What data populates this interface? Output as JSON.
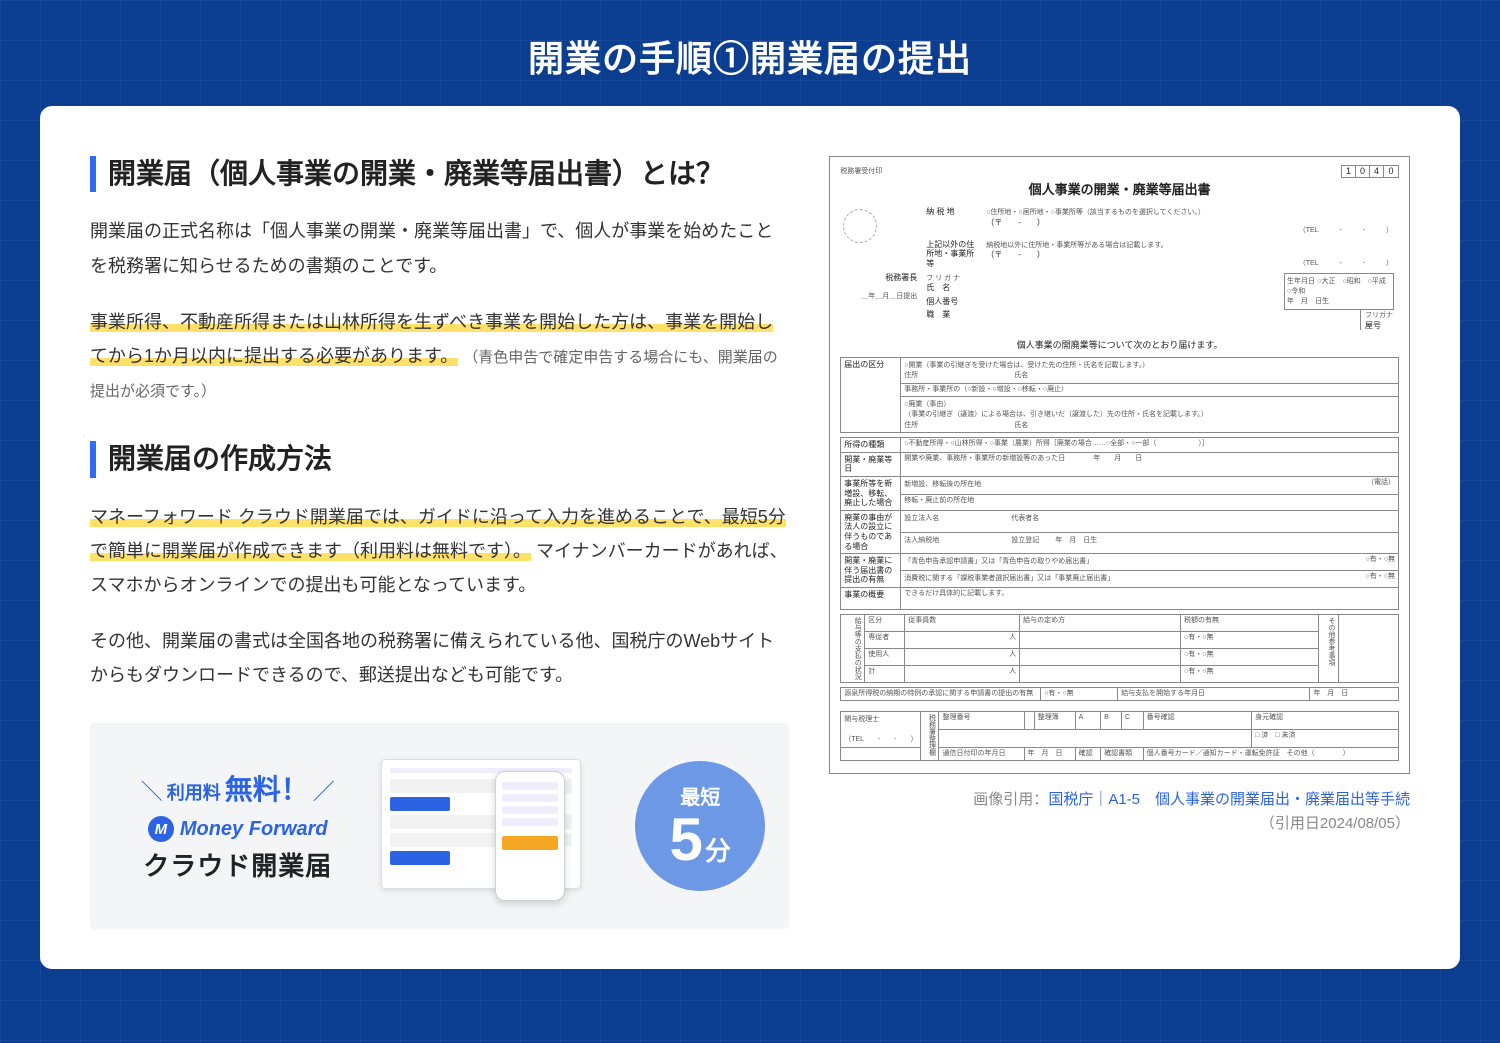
{
  "page_title": "開業の手順①開業届の提出",
  "section1": {
    "heading": "開業届（個人事業の開業・廃業等届出書）とは？",
    "para1": "開業届の正式名称は「個人事業の開業・廃業等届出書」で、個人が事業を始めたことを税務署に知らせるための書類のことです。",
    "highlight1": "事業所得、不動産所得または山林所得を生ずべき事業を開始した方は、事業を開始してから1か月以内に提出する必要があります。",
    "note1": "（青色申告で確定申告する場合にも、開業届の提出が必須です。）"
  },
  "section2": {
    "heading": "開業届の作成方法",
    "highlight2": "マネーフォワード クラウド開業届では、ガイドに沿って入力を進めることで、最短5分で簡単に開業届が作成できます（利用料は無料です）。",
    "para2_rest": "マイナンバーカードがあれば、スマホからオンラインでの提出も可能となっています。",
    "para3": "その他、開業届の書式は全国各地の税務署に備えられている他、国税庁のWebサイトからもダウンロードできるので、郵送提出なども可能です。"
  },
  "promo": {
    "free_prefix": "利用料",
    "free_big": "無料！",
    "brand": "Money Forward",
    "product": "クラウド開業届",
    "badge_line1": "最短",
    "badge_num": "5",
    "badge_unit": "分"
  },
  "form": {
    "reception_label": "税務署受付印",
    "code": [
      "1",
      "0",
      "4",
      "0"
    ],
    "title": "個人事業の開業・廃業等届出書",
    "field_address_note": "○住所地・○居所地・○事業所等（該当するものを選択してください。）",
    "tel_label": "（TEL　　　-　　　-　　　）",
    "tax_office_label": "税務署長",
    "submit_date_tpl": "＿年＿月＿日提出",
    "noukei_label": "納 税 地",
    "other_addr_label": "上記以外の住所地・事業所等",
    "other_addr_note": "納税地以外に住所地・事業所等がある場合は記載します。",
    "furigana": "フ リ ガ ナ",
    "name_label": "氏　名",
    "era_options": "○大正　○昭和　○平成　○令和",
    "birth_label": "生年月日",
    "ymd": "年　月　日生",
    "mynumber_label": "個人番号",
    "occupation_label": "職　業",
    "yago_furigana": "フリガナ",
    "yago_label": "屋号",
    "intro": "個人事業の開廃業等について次のとおり届けます。",
    "todokede_kubun_label": "届出の区分",
    "kubun_open": "○開業（事業の引継ぎを受けた場合は、受けた先の住所・氏名を記載します。）",
    "kubun_addr": "住所",
    "kubun_name": "氏名",
    "kubun_office": "事務所・事業所の（○新設・○増設・○移転・○廃止）",
    "kubun_close": "○廃業（事由）",
    "kubun_close_note": "（事業の引継ぎ（譲渡）による場合は、引き継いだ（譲渡した）先の住所・氏名を記載します。）",
    "income_type_label": "所得の種類",
    "income_type_value": "○不動産所得・○山林所得・○事業（農業）所得［廃業の場合……○全部・○一部（　　　　　　）］",
    "date_label": "開業・廃業等日",
    "date_value": "開業や廃業、事務所・事業所の新増設等のあった日　　　　年　　月　　日",
    "office_addr_label": "事業所等を新増設、移転、廃止した場合",
    "office_addr_row1": "新増設、移転後の所在地",
    "office_addr_tel": "（電話）",
    "office_addr_row2": "移転・廃止前の所在地",
    "corp_label": "廃業の事由が法人の設立に伴うものである場合",
    "corp_row1_l": "設立法人名",
    "corp_row1_r": "代表者名",
    "corp_row2_l": "法人納税地",
    "corp_row2_r": "設立登記",
    "related_label": "開業・廃業に伴う届出書の提出の有無",
    "related_row1": "「青色申告承認申請書」又は「青色申告の取りやめ届出書」",
    "related_yn": "○有・○無",
    "related_row2": "消費税に関する「課税事業者選択届出書」又は「事業廃止届出書」",
    "biz_summary_label": "事業の概要",
    "biz_summary_note": "できるだけ具体的に記載します。",
    "pay_table_header": "給与等の支払の状況",
    "pay_col_kubun": "区分",
    "pay_col_count": "従事員数",
    "pay_col_method": "給与の定め方",
    "pay_col_tax": "税額の有無",
    "pay_row_sen": "専従者",
    "pay_row_emp": "使用人",
    "pay_row_total": "計",
    "pay_unit": "人",
    "pay_yn": "○有・○無",
    "pay_side": "その他参考事項",
    "withholding_label": "源泉所得税の納期の特例の承認に関する申請書の提出の有無",
    "withholding_start": "給与支払を開始する年月日",
    "footer_label": "関与税理士",
    "footer_tel": "（TEL　　-　　-　　）",
    "footer_seiri": "整理番号",
    "footer_dept": "整理簿",
    "footer_abc_a": "A",
    "footer_abc_b": "B",
    "footer_abc_c": "C",
    "footer_check1": "番号確認",
    "footer_check2": "身元確認",
    "footer_check_opt": "□ 済　□ 未済",
    "footer_date": "通信日付印の年月日",
    "footer_confirm": "確認",
    "footer_docs_label": "確認書類",
    "footer_docs": "個人番号カード／通知カード・運転免許証　その他（　　　　）"
  },
  "citation": {
    "prefix": "画像引用：",
    "link_text": "国税庁｜A1-5　個人事業の開業届出・廃業届出等手続",
    "date_line": "（引用日2024/08/05）"
  }
}
